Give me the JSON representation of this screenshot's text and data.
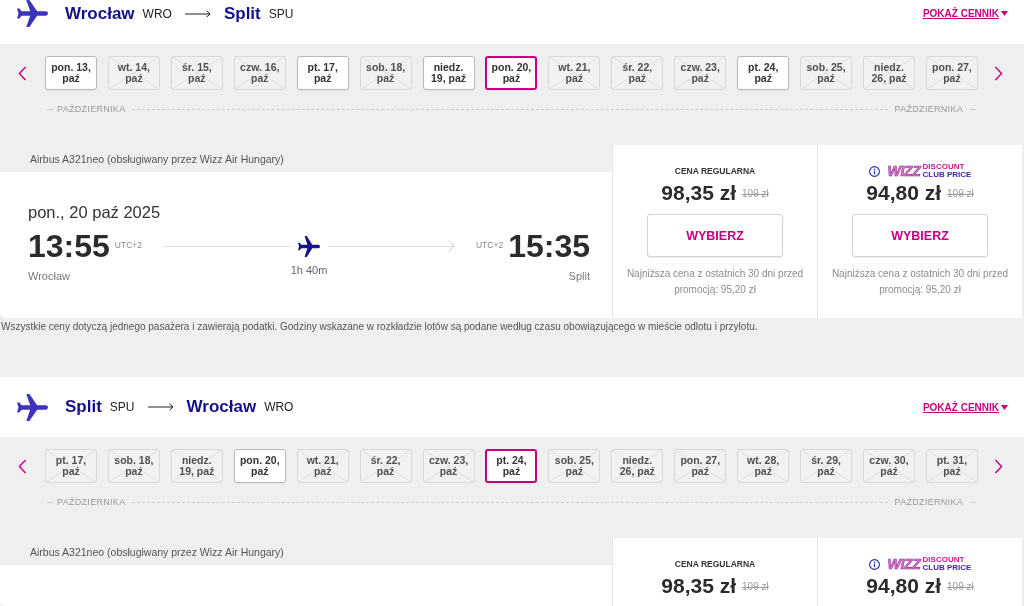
{
  "sections": [
    {
      "route": {
        "origin": {
          "city": "Wrocław",
          "code": "WRO"
        },
        "destination": {
          "city": "Split",
          "code": "SPU"
        }
      },
      "price_list_link": "POKAŻ CENNIK",
      "dates": [
        {
          "label": "pon. 13, paź",
          "available": true,
          "selected": false
        },
        {
          "label": "wt. 14, paź",
          "available": false,
          "selected": false
        },
        {
          "label": "śr. 15, paź",
          "available": false,
          "selected": false
        },
        {
          "label": "czw. 16, paź",
          "available": false,
          "selected": false
        },
        {
          "label": "pt. 17, paź",
          "available": true,
          "selected": false
        },
        {
          "label": "sob. 18, paź",
          "available": false,
          "selected": false
        },
        {
          "label": "niedz. 19, paź",
          "available": true,
          "selected": false
        },
        {
          "label": "pon. 20, paź",
          "available": true,
          "selected": true
        },
        {
          "label": "wt. 21, paź",
          "available": false,
          "selected": false
        },
        {
          "label": "śr. 22, paź",
          "available": false,
          "selected": false
        },
        {
          "label": "czw. 23, paź",
          "available": false,
          "selected": false
        },
        {
          "label": "pt. 24, paź",
          "available": true,
          "selected": false
        },
        {
          "label": "sob. 25, paź",
          "available": false,
          "selected": false
        },
        {
          "label": "niedz. 26, paź",
          "available": false,
          "selected": false
        },
        {
          "label": "pon. 27, paź",
          "available": false,
          "selected": false
        }
      ],
      "month_labels": [
        "PAŹDZIERNIKA",
        "PAŹDZIERNIKA"
      ],
      "flight": {
        "aircraft": "Airbus A321neo (obsługiwany przez Wizz Air Hungary)",
        "date": "pon., 20 paź 2025",
        "departure": {
          "time": "13:55",
          "timezone": "UTC+2",
          "city": "Wrocław"
        },
        "duration": "1h 40m",
        "arrival": {
          "time": "15:35",
          "timezone": "UTC+2",
          "city": "Split"
        },
        "fares": [
          {
            "kind": "regular",
            "title": "CENA REGULARNA",
            "price": "98,35 zł",
            "old_price": "109 zł",
            "button": "WYBIERZ",
            "note": "Najniższa cena z ostatnich 30 dni przed promocją: 95,20 zł"
          },
          {
            "kind": "club",
            "logo": {
              "wordmark": "WIZZ",
              "line_1": "DISCOUNT",
              "line_2": "CLUB PRICE"
            },
            "price": "94,80 zł",
            "old_price": "109 zł",
            "button": "WYBIERZ",
            "note": "Najniższa cena z ostatnich 30 dni przed promocją: 95,20 zł"
          }
        ]
      },
      "footnote": "Wszystkie ceny dotyczą jednego pasażera i zawierają podatki. Godziny wskazane w rozkładzie lotów są podane według czasu obowiązującego w mieście odlotu i przylotu."
    },
    {
      "route": {
        "origin": {
          "city": "Split",
          "code": "SPU"
        },
        "destination": {
          "city": "Wrocław",
          "code": "WRO"
        }
      },
      "price_list_link": "POKAŻ CENNIK",
      "dates": [
        {
          "label": "pt. 17, paź",
          "available": false,
          "selected": false
        },
        {
          "label": "sob. 18, paź",
          "available": false,
          "selected": false
        },
        {
          "label": "niedz. 19, paź",
          "available": false,
          "selected": false
        },
        {
          "label": "pon. 20, paź",
          "available": true,
          "selected": false
        },
        {
          "label": "wt. 21, paź",
          "available": false,
          "selected": false
        },
        {
          "label": "śr. 22, paź",
          "available": false,
          "selected": false
        },
        {
          "label": "czw. 23, paź",
          "available": false,
          "selected": false
        },
        {
          "label": "pt. 24, paź",
          "available": true,
          "selected": true
        },
        {
          "label": "sob. 25, paź",
          "available": false,
          "selected": false
        },
        {
          "label": "niedz. 26, paź",
          "available": false,
          "selected": false
        },
        {
          "label": "pon. 27, paź",
          "available": false,
          "selected": false
        },
        {
          "label": "wt. 28, paź",
          "available": false,
          "selected": false
        },
        {
          "label": "śr. 29, paź",
          "available": false,
          "selected": false
        },
        {
          "label": "czw. 30, paź",
          "available": false,
          "selected": false
        },
        {
          "label": "pt. 31, paź",
          "available": false,
          "selected": false
        }
      ],
      "month_labels": [
        "PAŹDZIERNIKA",
        "PAŹDZIERNIKA"
      ],
      "flight": {
        "aircraft": "Airbus A321neo (obsługiwany przez Wizz Air Hungary)",
        "fares": [
          {
            "kind": "regular",
            "title": "CENA REGULARNA",
            "price": "98,35 zł",
            "old_price": "109 zł"
          },
          {
            "kind": "club",
            "logo": {
              "wordmark": "WIZZ",
              "line_1": "DISCOUNT",
              "line_2": "CLUB PRICE"
            },
            "price": "94,80 zł",
            "old_price": "109 zł"
          }
        ]
      }
    }
  ]
}
